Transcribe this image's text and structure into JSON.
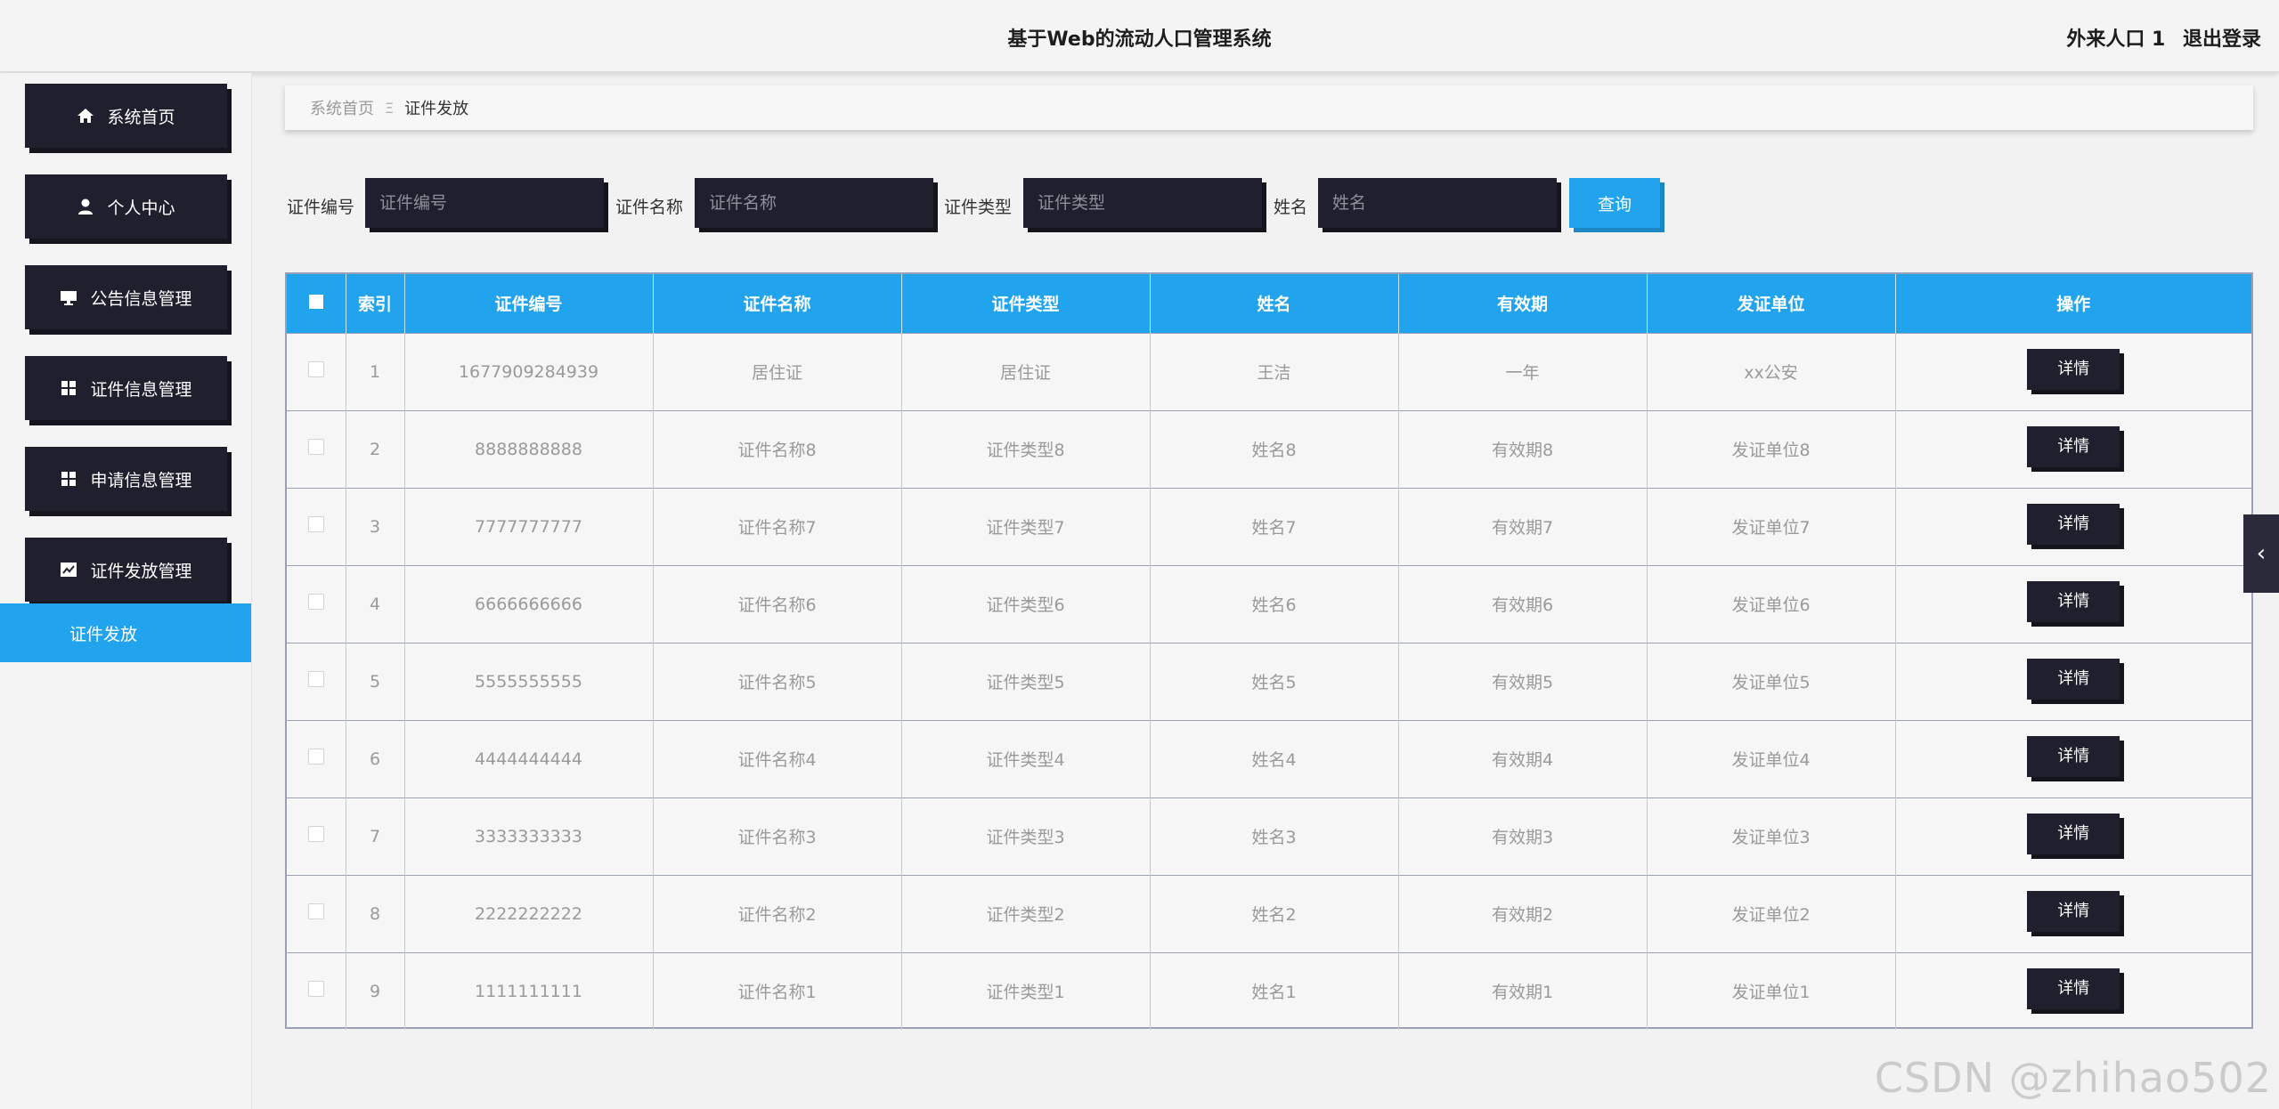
{
  "header": {
    "title": "基于Web的流动人口管理系统",
    "user": "外来人口 1",
    "logout": "退出登录"
  },
  "sidebar": {
    "items": [
      {
        "label": "系统首页",
        "icon": "home-icon"
      },
      {
        "label": "个人中心",
        "icon": "user-icon"
      },
      {
        "label": "公告信息管理",
        "icon": "monitor-icon"
      },
      {
        "label": "证件信息管理",
        "icon": "grid-icon"
      },
      {
        "label": "申请信息管理",
        "icon": "grid-icon"
      },
      {
        "label": "证件发放管理",
        "icon": "chart-icon"
      }
    ],
    "active_sub": "证件发放"
  },
  "breadcrumb": {
    "home": "系统首页",
    "separator": "Ξ",
    "current": "证件发放"
  },
  "search": {
    "fields": [
      {
        "label": "证件编号",
        "placeholder": "证件编号",
        "value": ""
      },
      {
        "label": "证件名称",
        "placeholder": "证件名称",
        "value": ""
      },
      {
        "label": "证件类型",
        "placeholder": "证件类型",
        "value": ""
      },
      {
        "label": "姓名",
        "placeholder": "姓名",
        "value": ""
      }
    ],
    "button": "查询"
  },
  "table": {
    "headers": [
      "索引",
      "证件编号",
      "证件名称",
      "证件类型",
      "姓名",
      "有效期",
      "发证单位",
      "操作"
    ],
    "action_label": "详情",
    "rows": [
      [
        "1",
        "1677909284939",
        "居住证",
        "居住证",
        "王洁",
        "一年",
        "xx公安"
      ],
      [
        "2",
        "8888888888",
        "证件名称8",
        "证件类型8",
        "姓名8",
        "有效期8",
        "发证单位8"
      ],
      [
        "3",
        "7777777777",
        "证件名称7",
        "证件类型7",
        "姓名7",
        "有效期7",
        "发证单位7"
      ],
      [
        "4",
        "6666666666",
        "证件名称6",
        "证件类型6",
        "姓名6",
        "有效期6",
        "发证单位6"
      ],
      [
        "5",
        "5555555555",
        "证件名称5",
        "证件类型5",
        "姓名5",
        "有效期5",
        "发证单位5"
      ],
      [
        "6",
        "4444444444",
        "证件名称4",
        "证件类型4",
        "姓名4",
        "有效期4",
        "发证单位4"
      ],
      [
        "7",
        "3333333333",
        "证件名称3",
        "证件类型3",
        "姓名3",
        "有效期3",
        "发证单位3"
      ],
      [
        "8",
        "2222222222",
        "证件名称2",
        "证件类型2",
        "姓名2",
        "有效期2",
        "发证单位2"
      ],
      [
        "9",
        "1111111111",
        "证件名称1",
        "证件类型1",
        "姓名1",
        "有效期1",
        "发证单位1"
      ]
    ]
  },
  "watermark": "CSDN @zhihao502",
  "colors": {
    "accent": "#22a3ee",
    "dark_block": "#1f1f2e",
    "background": "#f2f2f3"
  }
}
